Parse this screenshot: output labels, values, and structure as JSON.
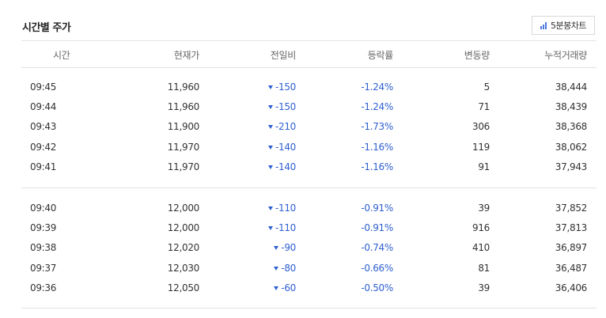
{
  "title": "시간별 주가",
  "chart_button": {
    "label": "5분봉차트",
    "icon": "bar-chart-icon",
    "accent": "#4b7bdb"
  },
  "colors": {
    "down": "#2e5fd1",
    "divider": "#e2e2e2"
  },
  "columns": [
    "시간",
    "현재가",
    "전일비",
    "등락률",
    "변동량",
    "누적거래량"
  ],
  "groups": [
    [
      {
        "time": "09:45",
        "price": "11,960",
        "change": "-150",
        "rate": "-1.24%",
        "volume": "5",
        "cumulative": "38,444"
      },
      {
        "time": "09:44",
        "price": "11,960",
        "change": "-150",
        "rate": "-1.24%",
        "volume": "71",
        "cumulative": "38,439"
      },
      {
        "time": "09:43",
        "price": "11,900",
        "change": "-210",
        "rate": "-1.73%",
        "volume": "306",
        "cumulative": "38,368"
      },
      {
        "time": "09:42",
        "price": "11,970",
        "change": "-140",
        "rate": "-1.16%",
        "volume": "119",
        "cumulative": "38,062"
      },
      {
        "time": "09:41",
        "price": "11,970",
        "change": "-140",
        "rate": "-1.16%",
        "volume": "91",
        "cumulative": "37,943"
      }
    ],
    [
      {
        "time": "09:40",
        "price": "12,000",
        "change": "-110",
        "rate": "-0.91%",
        "volume": "39",
        "cumulative": "37,852"
      },
      {
        "time": "09:39",
        "price": "12,000",
        "change": "-110",
        "rate": "-0.91%",
        "volume": "916",
        "cumulative": "37,813"
      },
      {
        "time": "09:38",
        "price": "12,020",
        "change": "-90",
        "rate": "-0.74%",
        "volume": "410",
        "cumulative": "36,897"
      },
      {
        "time": "09:37",
        "price": "12,030",
        "change": "-80",
        "rate": "-0.66%",
        "volume": "81",
        "cumulative": "36,487"
      },
      {
        "time": "09:36",
        "price": "12,050",
        "change": "-60",
        "rate": "-0.50%",
        "volume": "39",
        "cumulative": "36,406"
      }
    ]
  ]
}
